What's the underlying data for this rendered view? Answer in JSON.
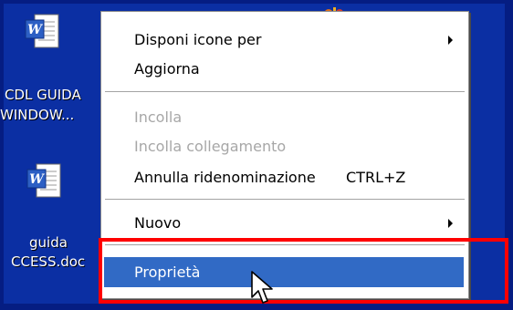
{
  "desktop": {
    "background": "#0b2fa3",
    "icons": [
      {
        "icon": "word-document-icon",
        "label_line1": "CDL GUIDA",
        "label_line2": "WINDOW..."
      },
      {
        "icon": "word-document-icon",
        "label_line1": "guida",
        "label_line2": "CCESS.doc"
      }
    ],
    "tray_icon": "alert-icon"
  },
  "context_menu": {
    "items": [
      {
        "label": "Disponi icone per",
        "submenu": true,
        "enabled": true
      },
      {
        "label": "Aggiorna",
        "enabled": true
      },
      {
        "label": "Incolla",
        "enabled": false
      },
      {
        "label": "Incolla collegamento",
        "enabled": false
      },
      {
        "label": "Annulla ridenominazione",
        "shortcut": "CTRL+Z",
        "enabled": true
      },
      {
        "label": "Nuovo",
        "submenu": true,
        "enabled": true
      },
      {
        "label": "Proprietà",
        "enabled": true,
        "highlighted": true
      }
    ],
    "highlight_color": "#316ac5"
  },
  "annotation": {
    "shape": "red-highlight-box",
    "color": "#ff0000"
  },
  "cursor": "arrow-cursor-icon"
}
